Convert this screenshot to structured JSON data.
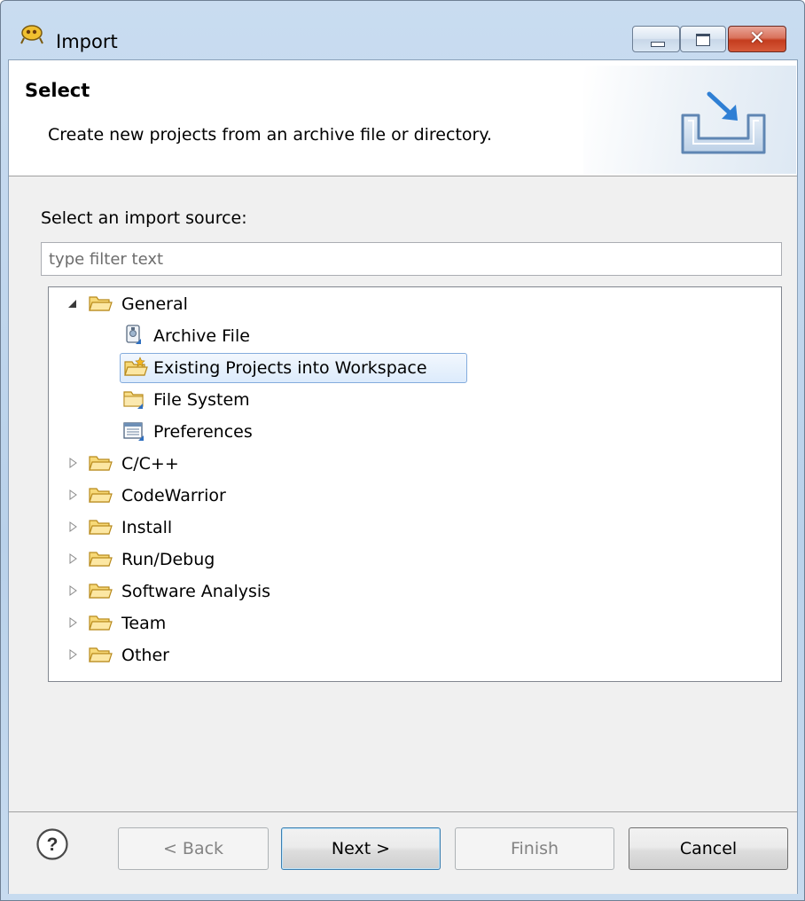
{
  "window": {
    "title": "Import"
  },
  "banner": {
    "title": "Select",
    "description": "Create new projects from an archive file or directory."
  },
  "source": {
    "label": "Select an import source:",
    "filter_placeholder": "type filter text"
  },
  "tree": {
    "items": [
      {
        "label": "General",
        "icon": "folder-icon",
        "expanded": true,
        "level": 0
      },
      {
        "label": "Archive File",
        "icon": "archive-file-icon",
        "level": 1
      },
      {
        "label": "Existing Projects into Workspace",
        "icon": "existing-projects-icon",
        "level": 1,
        "selected": true
      },
      {
        "label": "File System",
        "icon": "file-system-icon",
        "level": 1
      },
      {
        "label": "Preferences",
        "icon": "preferences-icon",
        "level": 1
      },
      {
        "label": "C/C++",
        "icon": "folder-icon",
        "expanded": false,
        "level": 0
      },
      {
        "label": "CodeWarrior",
        "icon": "folder-icon",
        "expanded": false,
        "level": 0
      },
      {
        "label": "Install",
        "icon": "folder-icon",
        "expanded": false,
        "level": 0
      },
      {
        "label": "Run/Debug",
        "icon": "folder-icon",
        "expanded": false,
        "level": 0
      },
      {
        "label": "Software Analysis",
        "icon": "folder-icon",
        "expanded": false,
        "level": 0
      },
      {
        "label": "Team",
        "icon": "folder-icon",
        "expanded": false,
        "level": 0
      },
      {
        "label": "Other",
        "icon": "folder-icon",
        "expanded": false,
        "level": 0
      }
    ]
  },
  "buttons": {
    "back": "< Back",
    "next": "Next >",
    "finish": "Finish",
    "cancel": "Cancel"
  },
  "colors": {
    "frame": "#b9d1ea",
    "selection_border": "#84acdd",
    "selection_fill": "#dcebfc",
    "folder": "#f5c542"
  }
}
